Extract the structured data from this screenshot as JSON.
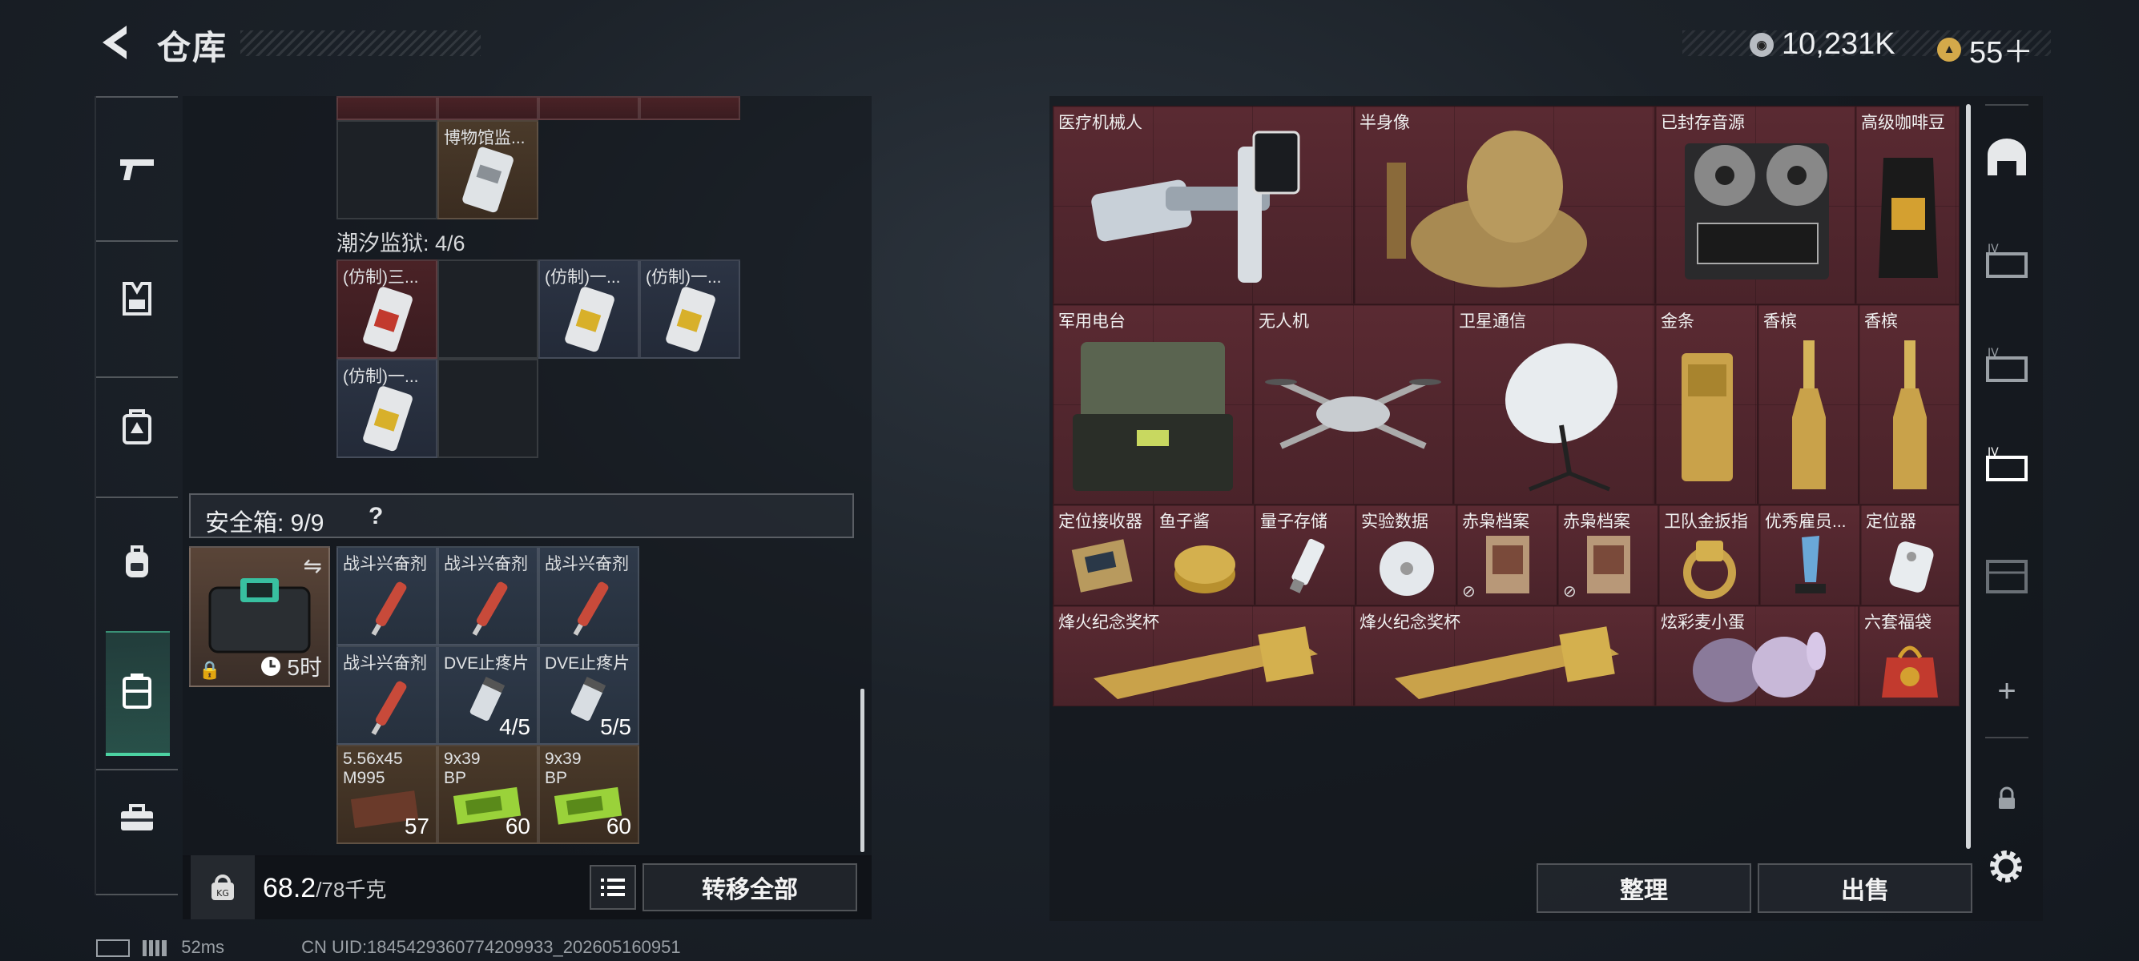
{
  "header": {
    "title": "仓库"
  },
  "currency": {
    "money": "10,231K",
    "tickets": "55＋"
  },
  "left_nav": [
    "pistol-icon",
    "armor-vest-icon",
    "chest-rig-icon",
    "backpack-icon",
    "safe-box-icon",
    "toolbox-icon"
  ],
  "prison": {
    "label": "潮汐监狱: 4/6"
  },
  "top_items": [
    {
      "name": "博物馆监...",
      "color": "amber"
    }
  ],
  "prison_items": [
    {
      "name": "(仿制)三...",
      "color": "red"
    },
    {
      "name": "(仿制)一...",
      "color": "blue"
    },
    {
      "name": "(仿制)一...",
      "color": "blue"
    },
    {
      "name": "(仿制)一...",
      "color": "blue"
    }
  ],
  "safe": {
    "title": "安全箱: 9/9",
    "help": "?",
    "timer": "5时"
  },
  "safe_items": [
    {
      "name": "战斗兴奋剂",
      "qty": ""
    },
    {
      "name": "战斗兴奋剂",
      "qty": ""
    },
    {
      "name": "战斗兴奋剂",
      "qty": ""
    },
    {
      "name": "战斗兴奋剂",
      "qty": ""
    },
    {
      "name": "DVE止疼片",
      "qty": "4/5"
    },
    {
      "name": "DVE止疼片",
      "qty": "5/5"
    },
    {
      "name": "5.56x45\nM995",
      "qty": "57"
    },
    {
      "name": "9x39\nBP",
      "qty": "60"
    },
    {
      "name": "9x39\nBP",
      "qty": "60"
    }
  ],
  "weight": {
    "value": "68.2",
    "max": "/78千克"
  },
  "buttons": {
    "transfer_all": "转移全部",
    "sort": "整理",
    "sell": "出售"
  },
  "status": {
    "ping": "52ms",
    "uid": "CN UID:1845429360774209933_202605160951"
  },
  "stash_items": [
    {
      "name": "医疗机械人"
    },
    {
      "name": "半身像"
    },
    {
      "name": "已封存音源"
    },
    {
      "name": "高级咖啡豆"
    },
    {
      "name": "军用电台"
    },
    {
      "name": "无人机"
    },
    {
      "name": "卫星通信"
    },
    {
      "name": "金条"
    },
    {
      "name": "香槟"
    },
    {
      "name": "香槟"
    },
    {
      "name": "定位接收器"
    },
    {
      "name": "鱼子酱"
    },
    {
      "name": "量子存储"
    },
    {
      "name": "实验数据"
    },
    {
      "name": "赤枭档案"
    },
    {
      "name": "赤枭档案"
    },
    {
      "name": "卫队金扳指"
    },
    {
      "name": "优秀雇员..."
    },
    {
      "name": "定位器"
    },
    {
      "name": "烽火纪念奖杯"
    },
    {
      "name": "烽火纪念奖杯"
    },
    {
      "name": "炫彩麦小蛋"
    },
    {
      "name": "六套福袋"
    }
  ],
  "right_nav": [
    "bunker-icon",
    "storage-page-1-icon",
    "storage-page-2-icon",
    "storage-page-3-icon",
    "storage-page-4-icon",
    "add-page-icon",
    "locked-page-icon"
  ],
  "colors": {
    "accent": "#4cd2a2",
    "valuable_red": "#5a2a32",
    "gold": "#c9a24a"
  }
}
